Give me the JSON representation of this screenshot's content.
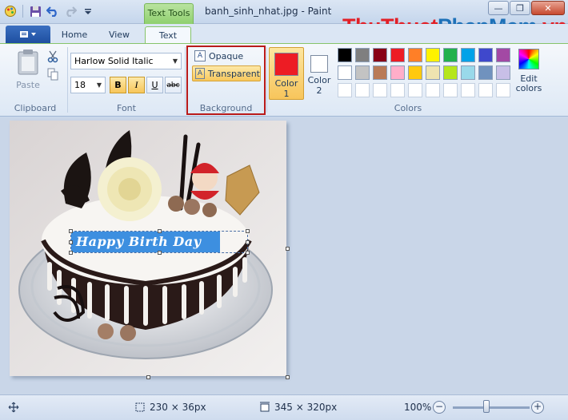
{
  "titlebar": {
    "contextual_tab": "Text Tools",
    "document_title": "banh_sinh_nhat.jpg - Paint",
    "min_glyph": "—",
    "max_glyph": "❐",
    "close_glyph": "✕"
  },
  "brand": {
    "part1": "ThuThuat",
    "part2": "PhanMem",
    "part3": ".vn"
  },
  "tabs": {
    "home": "Home",
    "view": "View",
    "text": "Text"
  },
  "ribbon": {
    "clipboard": {
      "paste_label": "Paste",
      "group_label": "Clipboard"
    },
    "font": {
      "family_value": "Harlow Solid Italic",
      "size_value": "18",
      "bold": "B",
      "italic": "I",
      "underline": "U",
      "strike": "abc",
      "group_label": "Font"
    },
    "background": {
      "opaque_label": "Opaque",
      "transparent_label": "Transparent",
      "group_label": "Background"
    },
    "colors": {
      "color1_label": "Color",
      "color1_num": "1",
      "color2_label": "Color",
      "color2_num": "2",
      "color1_value": "#ed1c24",
      "color2_value": "#ffffff",
      "edit_label_1": "Edit",
      "edit_label_2": "colors",
      "group_label": "Colors",
      "palette_row1": [
        "#000000",
        "#7f7f7f",
        "#880015",
        "#ed1c24",
        "#ff7f27",
        "#fff200",
        "#22b14c",
        "#00a2e8",
        "#3f48cc",
        "#a349a4"
      ],
      "palette_row2": [
        "#ffffff",
        "#c3c3c3",
        "#b97a57",
        "#ffaec9",
        "#ffc90e",
        "#efe4b0",
        "#b5e61d",
        "#99d9ea",
        "#7092be",
        "#c8bfe7"
      ],
      "palette_row3": [
        "#ffffff",
        "#ffffff",
        "#ffffff",
        "#ffffff",
        "#ffffff",
        "#ffffff",
        "#ffffff",
        "#ffffff",
        "#ffffff",
        "#ffffff"
      ]
    }
  },
  "canvas": {
    "text_box_value": "Happy Birth Day",
    "text_box_color": "#ffffff",
    "text_box_bg": "#3d8fe0"
  },
  "statusbar": {
    "selection_size": "230 × 36px",
    "image_size": "345 × 320px",
    "zoom": "100%",
    "zoom_level_pct": 100,
    "zoom_out": "−",
    "zoom_in": "+"
  }
}
